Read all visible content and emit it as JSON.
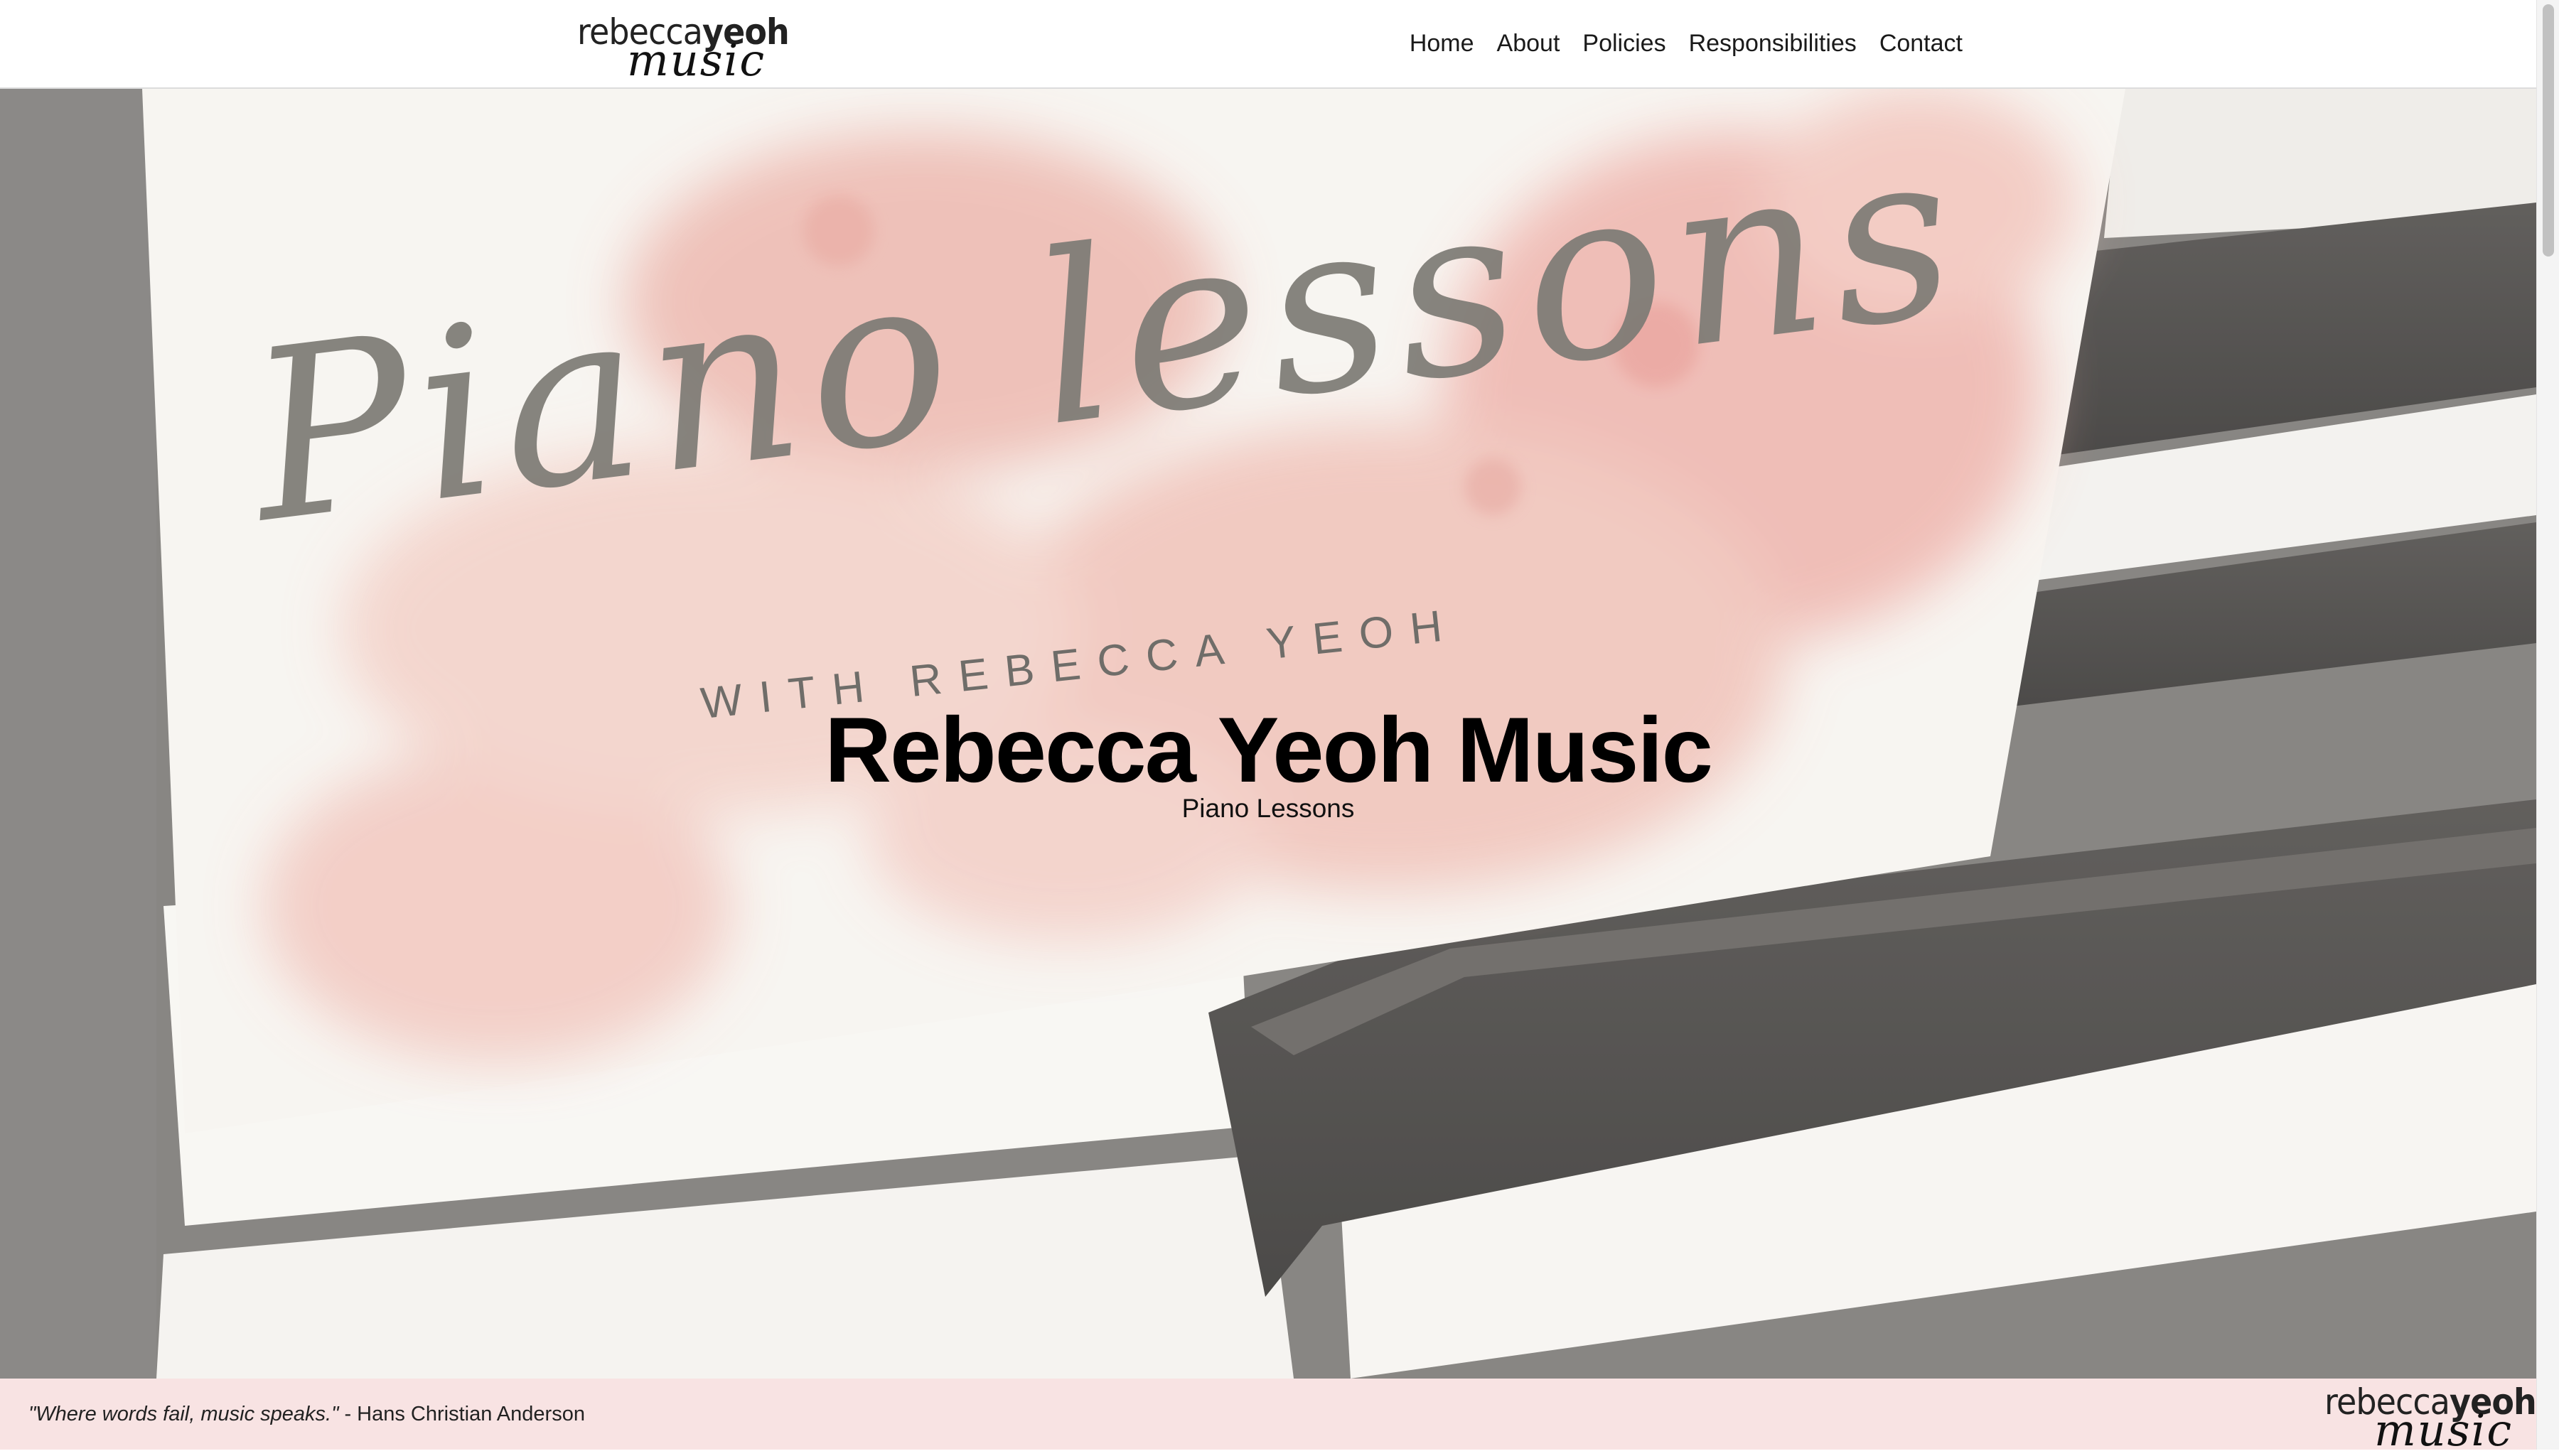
{
  "header": {
    "logo": {
      "top": "rebeccayeoh",
      "top_light": "rebecca",
      "top_heavy": "yeoh",
      "bottom": "music"
    },
    "nav": [
      "Home",
      "About",
      "Policies",
      "Responsibilities",
      "Contact"
    ]
  },
  "hero": {
    "title": "Rebecca Yeoh Music",
    "subtitle": "Piano Lessons",
    "card_script": "Piano lessons",
    "card_sub": "WITH REBECCA YEOH"
  },
  "footer": {
    "quote": "\"Where words fail, music speaks.\"",
    "attribution": " - Hans Christian Anderson",
    "logo": {
      "top_light": "rebecca",
      "top_heavy": "yeoh",
      "bottom": "music"
    }
  },
  "colors": {
    "footer_bg": "#f8e3e3",
    "watercolor": "#e9a79c",
    "card": "#f6f3ee",
    "black_key": "#2e2b28"
  }
}
